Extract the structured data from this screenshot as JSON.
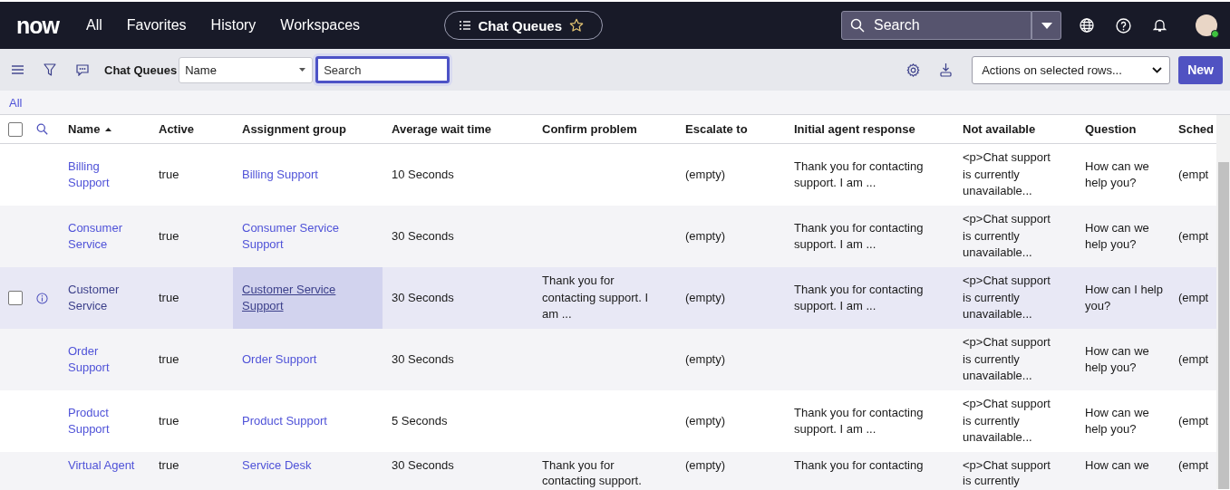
{
  "nav": {
    "logo": "now",
    "items": [
      "All",
      "Favorites",
      "History",
      "Workspaces"
    ],
    "context": {
      "title": "Chat Queues",
      "favorite": false
    },
    "search": {
      "placeholder": "Search"
    }
  },
  "list_toolbar": {
    "title": "Chat Queues",
    "field_select": {
      "value": "Name"
    },
    "search": {
      "placeholder": "Search",
      "focused": true
    },
    "actions_select": {
      "value": "Actions on selected rows..."
    },
    "new_button": "New"
  },
  "breadcrumb": [
    "All"
  ],
  "table": {
    "select_all_checked": false,
    "columns": [
      {
        "label": "Name",
        "kind": "link",
        "sorted": true
      },
      {
        "label": "Active",
        "kind": "text",
        "sorted": false
      },
      {
        "label": "Assignment group",
        "kind": "link",
        "sorted": false
      },
      {
        "label": "Average wait time",
        "kind": "text",
        "sorted": false
      },
      {
        "label": "Confirm problem",
        "kind": "text",
        "sorted": false
      },
      {
        "label": "Escalate to",
        "kind": "text",
        "sorted": false
      },
      {
        "label": "Initial agent response",
        "kind": "text",
        "sorted": false
      },
      {
        "label": "Not available",
        "kind": "text",
        "sorted": false
      },
      {
        "label": "Question",
        "kind": "text",
        "sorted": false
      },
      {
        "label": "Sched",
        "kind": "text",
        "sorted": false
      }
    ],
    "rows": [
      {
        "hovered": false,
        "checked": false,
        "cells": [
          "Billing Support",
          "true",
          "Billing Support",
          "10 Seconds",
          "",
          "(empty)",
          "Thank you for contacting support. I am ...",
          "<p>Chat support is currently unavailable...",
          "How can we help you?",
          "(empt"
        ]
      },
      {
        "hovered": false,
        "checked": false,
        "cells": [
          "Consumer Service",
          "true",
          "Consumer Service Support",
          "30 Seconds",
          "",
          "(empty)",
          "Thank you for contacting support. I am ...",
          "<p>Chat support is currently unavailable...",
          "How can we help you?",
          "(empt"
        ]
      },
      {
        "hovered": true,
        "checked": false,
        "cells": [
          "Customer Service",
          "true",
          "Customer Service Support",
          "30 Seconds",
          "Thank you for contacting support. I am ...",
          "(empty)",
          "Thank you for contacting support. I am ...",
          "<p>Chat support is currently unavailable...",
          "How can I help you?",
          "(empt"
        ]
      },
      {
        "hovered": false,
        "checked": false,
        "cells": [
          "Order Support",
          "true",
          "Order Support",
          "30 Seconds",
          "",
          "(empty)",
          "",
          "<p>Chat support is currently unavailable...",
          "How can we help you?",
          "(empt"
        ]
      },
      {
        "hovered": false,
        "checked": false,
        "cells": [
          "Product Support",
          "true",
          "Product Support",
          "5 Seconds",
          "",
          "(empty)",
          "Thank you for contacting support. I am ...",
          "<p>Chat support is currently unavailable...",
          "How can we help you?",
          "(empt"
        ]
      },
      {
        "hovered": false,
        "checked": false,
        "cells": [
          "Virtual Agent",
          "true",
          "Service Desk",
          "30 Seconds",
          "Thank you for contacting support.",
          "(empty)",
          "Thank you for contacting",
          "<p>Chat support is currently",
          "How can we",
          "(empt"
        ]
      }
    ]
  }
}
